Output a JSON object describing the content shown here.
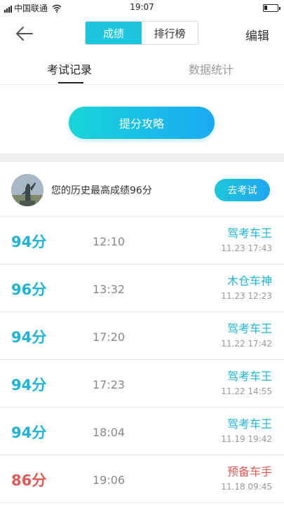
{
  "status_bar": {
    "carrier": "中国联通",
    "time": "19:07"
  },
  "header": {
    "segments": [
      {
        "label": "成绩",
        "active": true
      },
      {
        "label": "排行榜",
        "active": false
      }
    ],
    "edit_label": "编辑"
  },
  "subtabs": [
    {
      "label": "考试记录",
      "active": true
    },
    {
      "label": "数据统计",
      "active": false
    }
  ],
  "tips_button": "提分攻略",
  "best": {
    "text": "您的历史最高成绩96分",
    "exam_button": "去考试"
  },
  "records": [
    {
      "score": "94分",
      "duration": "12:10",
      "title": "驾考车王",
      "date": "11.23  17:43",
      "low": false
    },
    {
      "score": "96分",
      "duration": "13:32",
      "title": "木仓车神",
      "date": "11.23  12:23",
      "low": false
    },
    {
      "score": "94分",
      "duration": "17:20",
      "title": "驾考车王",
      "date": "11.22  17:42",
      "low": false
    },
    {
      "score": "94分",
      "duration": "17:23",
      "title": "驾考车王",
      "date": "11.22  14:55",
      "low": false
    },
    {
      "score": "94分",
      "duration": "18:04",
      "title": "驾考车王",
      "date": "11.19  19:42",
      "low": false
    },
    {
      "score": "86分",
      "duration": "19:06",
      "title": "预备车手",
      "date": "11.18  09:45",
      "low": true
    }
  ],
  "colors": {
    "accent": "#1ec6dd",
    "low_score": "#e05a55"
  }
}
